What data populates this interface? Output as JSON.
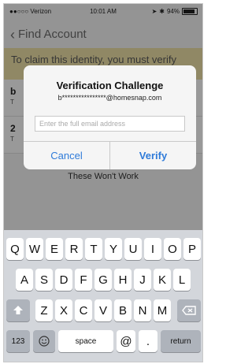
{
  "status": {
    "carrier": "●●○○○ Verizon",
    "time": "10:01 AM",
    "battery": "94%"
  },
  "nav": {
    "back_label": "Find Account"
  },
  "banner": {
    "text": "To claim this identity, you must verify"
  },
  "rows": [
    {
      "prefix": "b",
      "sub": "T"
    },
    {
      "prefix": "2",
      "sub": "T"
    }
  ],
  "footer_text": "These Won't Work",
  "dialog": {
    "title": "Verification Challenge",
    "message": "b****************@homesnap.com",
    "input_placeholder": "Enter the full email address",
    "cancel_label": "Cancel",
    "verify_label": "Verify",
    "button_color": "#2f7bd9"
  },
  "keyboard": {
    "row1": [
      "Q",
      "W",
      "E",
      "R",
      "T",
      "Y",
      "U",
      "I",
      "O",
      "P"
    ],
    "row2": [
      "A",
      "S",
      "D",
      "F",
      "G",
      "H",
      "J",
      "K",
      "L"
    ],
    "row3": [
      "Z",
      "X",
      "C",
      "V",
      "B",
      "N",
      "M"
    ],
    "numbers_label": "123",
    "space_label": "space",
    "at_label": "@",
    "dot_label": ".",
    "return_label": "return",
    "shift_icon": "shift-icon",
    "delete_icon": "delete-icon",
    "emoji_icon": "emoji-icon"
  }
}
